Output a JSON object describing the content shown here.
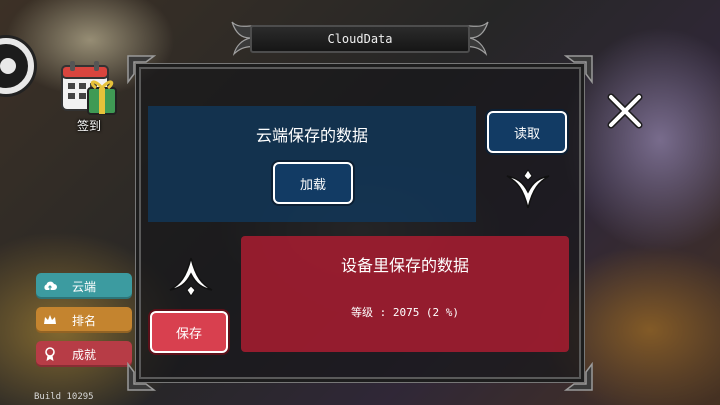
{
  "window": {
    "title": "CloudData"
  },
  "sidebar": {
    "calendar_label": "签到",
    "items": [
      {
        "label": "云端",
        "icon": "cloud-icon",
        "color": "#3c9ba0"
      },
      {
        "label": "排名",
        "icon": "crown-icon",
        "color": "#c4842f"
      },
      {
        "label": "成就",
        "icon": "medal-icon",
        "color": "#b73c46"
      }
    ]
  },
  "build": "Build 10295",
  "cloud": {
    "title": "云端保存的数据",
    "load_label": "加载",
    "read_label": "读取",
    "color": "#11385c"
  },
  "device": {
    "title": "设备里保存的数据",
    "level_text": "等级 : 2075 (2 %)",
    "save_label": "保存",
    "color": "#a51c30"
  },
  "icons": {
    "close": "close-icon",
    "transfer_down": "arrow-down-icon",
    "transfer_up": "arrow-up-icon"
  }
}
